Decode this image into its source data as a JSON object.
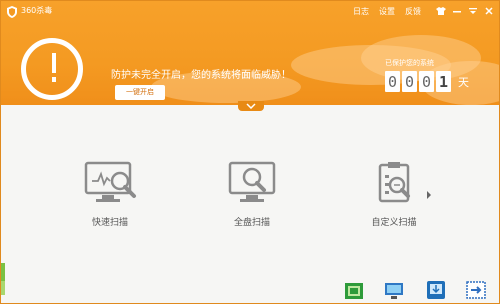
{
  "app": {
    "title": "360杀毒"
  },
  "menu": {
    "log": "日志",
    "settings": "设置",
    "feedback": "反馈"
  },
  "banner": {
    "warning": "防护未完全开启，您的系统将面临威胁！",
    "enable_button": "一键开启",
    "protected_label": "已保护您的系统",
    "digits": [
      "0",
      "0",
      "0",
      "1"
    ],
    "day_unit": "天"
  },
  "scan": {
    "quick": "快速扫描",
    "full": "全盘扫描",
    "custom": "自定义扫描"
  },
  "icons": {
    "logo": "shield-icon",
    "alert": "exclamation-icon",
    "quick": "monitor-magnifier-icon",
    "full": "monitor-search-icon",
    "custom": "clipboard-search-icon",
    "tools": [
      "chip-icon",
      "monitor-tool-icon",
      "download-tool-icon",
      "arrow-exit-icon"
    ]
  },
  "colors": {
    "brand_orange": "#f49a22",
    "accent_green": "#7ac143"
  }
}
